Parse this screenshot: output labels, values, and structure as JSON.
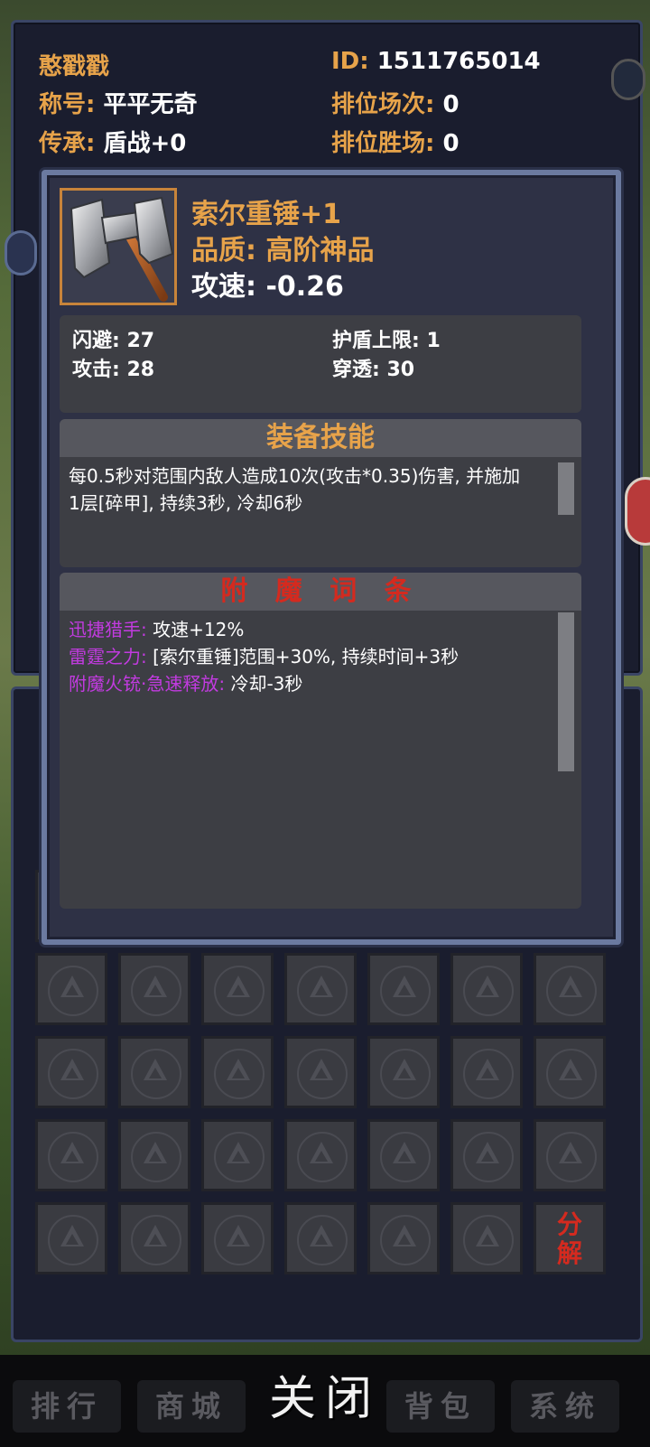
{
  "profile": {
    "name": "憨戳戳",
    "id_label": "ID:",
    "id_value": "1511765014",
    "title_label": "称号:",
    "title_value": "平平无奇",
    "inherit_label": "传承:",
    "inherit_value": "盾战+0",
    "rank_matches_label": "排位场次:",
    "rank_matches_value": "0",
    "rank_wins_label": "排位胜场:",
    "rank_wins_value": "0"
  },
  "item": {
    "name": "索尔重锤+1",
    "quality": "品质: 高阶神品",
    "attack_speed": "攻速: -0.26",
    "icon": "hammer-icon",
    "stats": [
      {
        "label": "闪避: 27"
      },
      {
        "label": "护盾上限: 1"
      },
      {
        "label": "攻击: 28"
      },
      {
        "label": "穿透: 30"
      }
    ]
  },
  "skill": {
    "title": "装备技能",
    "desc_line1": "每0.5秒对范围内敌人造成10次(攻击*0.35)伤害, 并施加",
    "desc_line2": "1层[碎甲], 持续3秒, 冷却6秒"
  },
  "enchant": {
    "title": "附 魔 词 条",
    "entries": [
      {
        "name": "迅捷猎手:",
        "effect": "攻速+12%"
      },
      {
        "name": "雷霆之力:",
        "effect": "[索尔重锤]范围+30%, 持续时间+3秒"
      },
      {
        "name": "附魔火铳·急速释放:",
        "effect": "冷却-3秒"
      }
    ]
  },
  "inventory": {
    "decompose_label_1": "分",
    "decompose_label_2": "解"
  },
  "nav": {
    "items": [
      "排行",
      "商城",
      "背包",
      "系统"
    ],
    "close_label": "关闭"
  },
  "colors": {
    "gold": "#e7a34a",
    "red_title": "#d42a1f",
    "purple": "#c23be0",
    "panel_bg": "#2e3145"
  }
}
